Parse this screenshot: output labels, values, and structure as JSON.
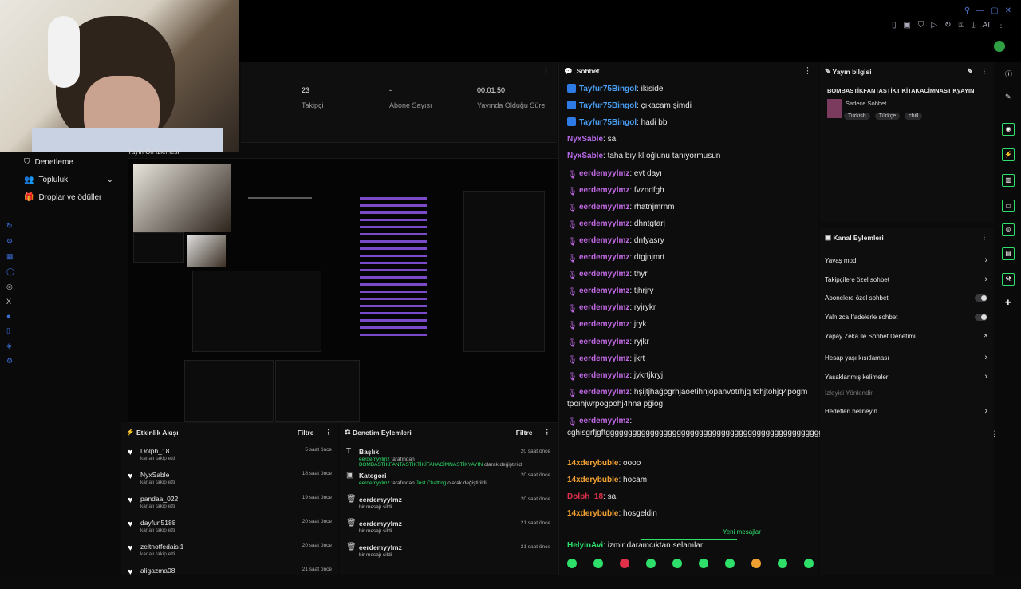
{
  "stats": [
    {
      "value": "23",
      "label": "Takipçi"
    },
    {
      "value": "-",
      "label": "Abone Sayısı"
    },
    {
      "value": "00:01:50",
      "label": "Yayında Olduğu Süre"
    }
  ],
  "preview": {
    "label": "Yayın Ön İzlemesi"
  },
  "sidebar": {
    "items": [
      {
        "label": "Denetleme",
        "icon": "shield-icon"
      },
      {
        "label": "Topluluk",
        "icon": "users-icon"
      },
      {
        "label": "Droplar ve ödüller",
        "icon": "gift-icon"
      }
    ]
  },
  "events": {
    "title": "Etkinlik Akışı",
    "filter": "Filtre",
    "rows": [
      {
        "name": "Dolph_18",
        "sub": "kanalı takip etti",
        "time": "5 saat önce"
      },
      {
        "name": "NyxSable",
        "sub": "kanalı takip etti",
        "time": "18 saat önce"
      },
      {
        "name": "pandaa_022",
        "sub": "kanalı takip etti",
        "time": "19 saat önce"
      },
      {
        "name": "dayfun5188",
        "sub": "kanalı takip etti",
        "time": "20 saat önce"
      },
      {
        "name": "zeltnotfedaisi1",
        "sub": "kanalı takip etti",
        "time": "20 saat önce"
      },
      {
        "name": "aligazma08",
        "sub": "",
        "time": "21 saat önce"
      }
    ]
  },
  "moderation": {
    "title": "Denetim Eylemleri",
    "filter": "Filtre",
    "rows": [
      {
        "name": "Başlık",
        "actor": "eerdemyylmz",
        "mid": " tarafından ",
        "value": "BOMBASTİKFANTASTİKTİKİTAKACİMNASTİKYAYIN",
        "tail": " olarak değiştirildi",
        "time": "20 saat önce"
      },
      {
        "name": "Kategori",
        "actor": "eerdemyylmz",
        "mid": " tarafından ",
        "value": "Just Chatting",
        "tail": " olarak değiştirildi",
        "time": "20 saat önce"
      },
      {
        "name": "eerdemyylmz",
        "sub": "bir mesajı sildi",
        "time": "20 saat önce"
      },
      {
        "name": "eerdemyylmz",
        "sub": "bir mesajı sildi",
        "time": "21 saat önce"
      },
      {
        "name": "eerdemyylmz",
        "sub": "bir mesajı sildi",
        "time": "21 saat önce"
      }
    ]
  },
  "chat": {
    "title": "Sohbet",
    "new_messages": "Yeni mesajlar",
    "messages": [
      {
        "user": "Tayfur75Bingol",
        "text": ": ikiside",
        "color": "#4a9ff5",
        "badge": "blue"
      },
      {
        "user": "Tayfur75Bingol",
        "text": ": çıkacam şimdi",
        "color": "#4a9ff5",
        "badge": "blue"
      },
      {
        "user": "Tayfur75Bingol",
        "text": ": hadi bb",
        "color": "#4a9ff5",
        "badge": "blue"
      },
      {
        "user": "NyxSable",
        "text": ": sa",
        "color": "#b86ae8",
        "badge": ""
      },
      {
        "user": "NyxSable",
        "text": ": taha bıyıklıoğlunu tanıyormusun",
        "color": "#b86ae8",
        "badge": ""
      },
      {
        "user": "eerdemyylmz",
        "text": ": evt dayı",
        "color": "#c36ae6",
        "badge": "mic"
      },
      {
        "user": "eerdemyylmz",
        "text": ": fvzndfgh",
        "color": "#c36ae6",
        "badge": "mic"
      },
      {
        "user": "eerdemyylmz",
        "text": ": rhatnjmrnm",
        "color": "#c36ae6",
        "badge": "mic"
      },
      {
        "user": "eerdemyylmz",
        "text": ": dhntgtarj",
        "color": "#c36ae6",
        "badge": "mic"
      },
      {
        "user": "eerdemyylmz",
        "text": ": dnfyasry",
        "color": "#c36ae6",
        "badge": "mic"
      },
      {
        "user": "eerdemyylmz",
        "text": ": dtgjnjmrt",
        "color": "#c36ae6",
        "badge": "mic"
      },
      {
        "user": "eerdemyylmz",
        "text": ": thyr",
        "color": "#c36ae6",
        "badge": "mic"
      },
      {
        "user": "eerdemyylmz",
        "text": ": tjhrjry",
        "color": "#c36ae6",
        "badge": "mic"
      },
      {
        "user": "eerdemyylmz",
        "text": ": ryjrykr",
        "color": "#c36ae6",
        "badge": "mic"
      },
      {
        "user": "eerdemyylmz",
        "text": ": jryk",
        "color": "#c36ae6",
        "badge": "mic"
      },
      {
        "user": "eerdemyylmz",
        "text": ": ryjkr",
        "color": "#c36ae6",
        "badge": "mic"
      },
      {
        "user": "eerdemyylmz",
        "text": ": jkrt",
        "color": "#c36ae6",
        "badge": "mic"
      },
      {
        "user": "eerdemyylmz",
        "text": ": jykrtjkryj",
        "color": "#c36ae6",
        "badge": "mic"
      },
      {
        "user": "eerdemyylmz",
        "text": ": hşijtjhağpgrhjaoetihnjopanvotrhjq tohjtohjq4pogm tpoıhjwrpogpohj4hna pğiog",
        "color": "#c36ae6",
        "badge": "mic"
      },
      {
        "user": "eerdemyylmz",
        "text": ": cghisgrfjgftggggggggggggggggggggggggggggggggggggggggggggggggggggggggggggggggggggggggggggggggggggggggggg",
        "color": "#c36ae6",
        "badge": "mic"
      },
      {
        "user": "14xderybuble",
        "text": ": oooo",
        "color": "#f0a030",
        "badge": ""
      },
      {
        "user": "14xderybuble",
        "text": ": hocam",
        "color": "#f0a030",
        "badge": ""
      },
      {
        "user": "Dolph_18",
        "text": ": sa",
        "color": "#e0304a",
        "badge": ""
      },
      {
        "user": "14xderybuble",
        "text": ": hosgeldin",
        "color": "#f0a030",
        "badge": ""
      },
      {
        "user": "HelyinAvi",
        "text": ": izmir daramcıktan selamlar",
        "color": "#2ee06a",
        "badge": ""
      }
    ]
  },
  "info": {
    "title": "Yayın bilgisi",
    "stream_title": "BOMBASTİKFANTASTİKTİKİTAKACİMNASTİKyAYIN",
    "category": "Sadece Sohbet",
    "tags": [
      "Turkish",
      "Türkçe",
      "chill"
    ]
  },
  "actions": {
    "title": "Kanal Eylemleri",
    "items": [
      {
        "label": "Yavaş mod",
        "kind": "arrow"
      },
      {
        "label": "Takipçilere özel sohbet",
        "kind": "arrow"
      },
      {
        "label": "Abonelere özel sohbet",
        "kind": "toggle"
      },
      {
        "label": "Yalnızca İfadelerle sohbet",
        "kind": "toggle"
      },
      {
        "label": "Yapay Zeka ile Sohbet Denetimi",
        "kind": "ext"
      },
      {
        "label": "Hesap yaşı kısıtlaması",
        "kind": "arrow"
      },
      {
        "label": "Yasaklanmış kelimeler",
        "kind": "arrow"
      },
      {
        "label": "İzleyici Yönlendir",
        "kind": "disabled"
      },
      {
        "label": "Hedefleri belirleyin",
        "kind": "arrow"
      }
    ]
  },
  "colors": {
    "accent": "#2ee06a",
    "mod_purple": "#c36ae6",
    "link_blue": "#4a9ff5"
  }
}
